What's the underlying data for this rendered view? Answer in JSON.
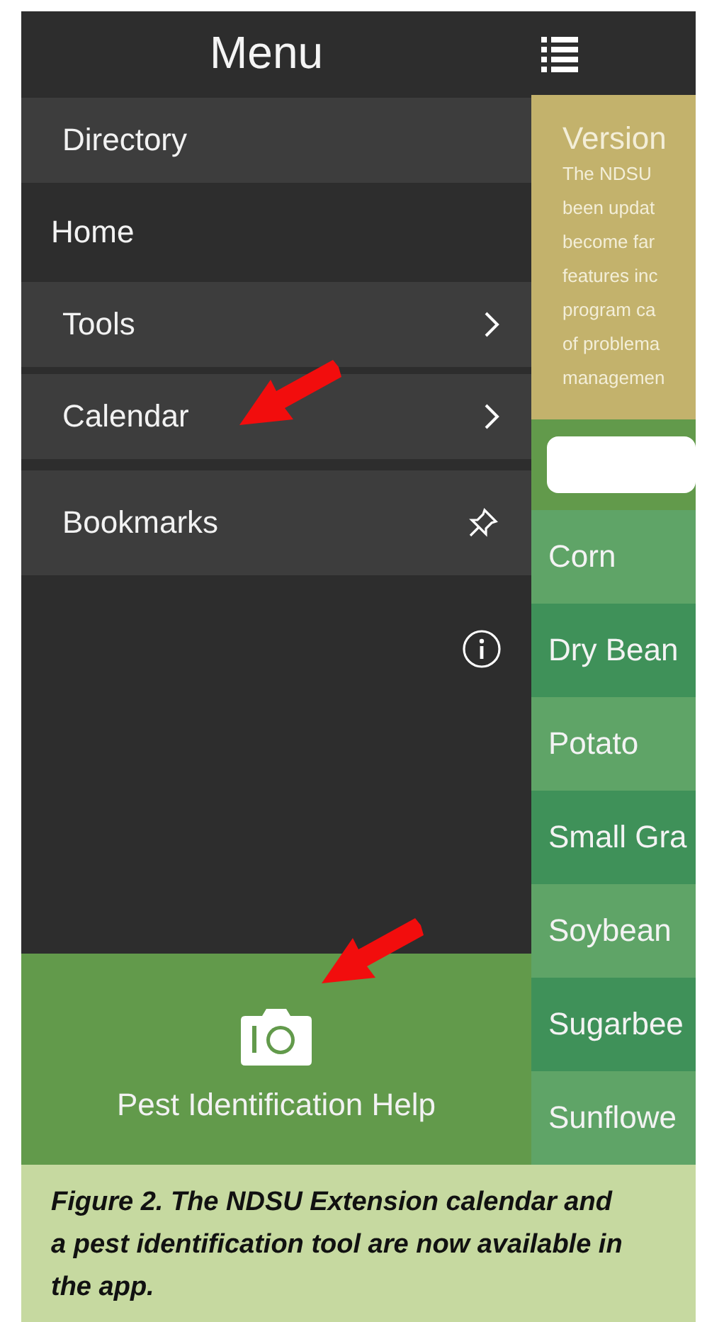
{
  "header": {
    "title": "Menu"
  },
  "menu": {
    "items": [
      {
        "label": "Directory",
        "kind": "section"
      },
      {
        "label": "Home",
        "kind": "plain"
      },
      {
        "label": "Tools",
        "kind": "submenu"
      },
      {
        "label": "Calendar",
        "kind": "submenu"
      },
      {
        "label": "Bookmarks",
        "kind": "pinned"
      }
    ]
  },
  "footer": {
    "label": "Pest Identification Help"
  },
  "panel": {
    "title": "Version",
    "lines": [
      "The NDSU",
      "been updat",
      "become far",
      "features inc",
      "program ca",
      "of problema",
      "managemen"
    ]
  },
  "crops": [
    "Corn",
    "Dry Bean",
    "Potato",
    "Small Gra",
    "Soybean",
    "Sugarbee",
    "Sunflowe"
  ],
  "caption": "Figure 2. The NDSU Extension calendar and a pest identification tool are now available in the app."
}
